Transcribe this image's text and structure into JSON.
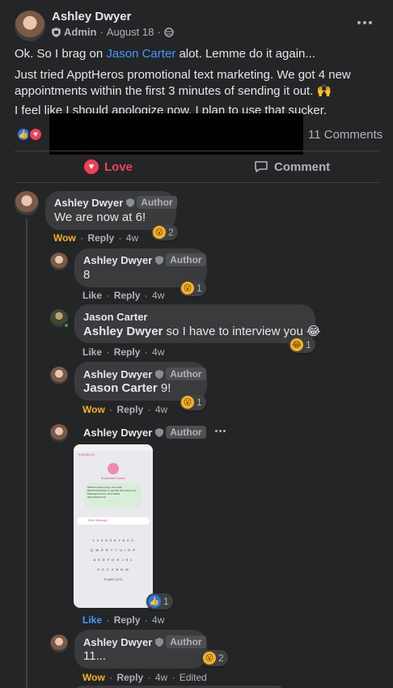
{
  "post": {
    "author": "Ashley Dwyer",
    "role": "Admin",
    "date": "August 18",
    "line1_pre": "Ok. So I brag on ",
    "line1_link": "Jason Carter",
    "line1_post": " alot. Lemme do it again...",
    "line2": "Just tried ApptHeros promotional text marketing. We got 4 new appointments within the first 3 minutes of sending it out. 🙌",
    "line3": "I feel like I should apologize now. I plan to use that sucker.",
    "comments_count": "11 Comments",
    "more_icon": "more-horizontal-icon"
  },
  "actions": {
    "love_label": "Love",
    "comment_label": "Comment"
  },
  "comments": [
    {
      "name": "Ashley Dwyer",
      "badge": "Author",
      "text": "We are now at 6!",
      "reaction": "Wow",
      "reply": "Reply",
      "time": "4w",
      "react_count": "2"
    },
    {
      "name": "Ashley Dwyer",
      "badge": "Author",
      "text": "8",
      "reaction": "Like",
      "reply": "Reply",
      "time": "4w",
      "react_count": "1"
    },
    {
      "name": "Jason Carter",
      "mention": "Ashley Dwyer",
      "text": " so I have to interview you 😂",
      "reaction": "Like",
      "reply": "Reply",
      "time": "4w",
      "react_count": "1"
    },
    {
      "name": "Ashley Dwyer",
      "badge": "Author",
      "mention": "Jason Carter",
      "text": " 9!",
      "reaction": "Wow",
      "reply": "Reply",
      "time": "4w",
      "react_count": "1"
    },
    {
      "name": "Ashley Dwyer",
      "badge": "Author",
      "reaction": "Like",
      "reply": "Reply",
      "time": "4w",
      "react_count": "1",
      "image": {
        "number": "918246124",
        "title": "Suspected Spam",
        "body": "2020 has been rough. Use code BACKTOSCHOOL to get $15 off at Flex & Ice Massage Hurt for more details https://appt.heros",
        "input": "Enter Message",
        "keys_row1": "1 2 3 4 5 6 7 8 9 0",
        "keys_row2": "Q W E R T Y U I O P",
        "keys_row3": "A S D F G H J K L",
        "keys_row4": "Z X C V B N M",
        "lang": "English (US)"
      }
    },
    {
      "name": "Ashley Dwyer",
      "badge": "Author",
      "text": "11...",
      "reaction": "Wow",
      "reply": "Reply",
      "time": "4w",
      "edited": "Edited",
      "react_count": "2"
    }
  ]
}
